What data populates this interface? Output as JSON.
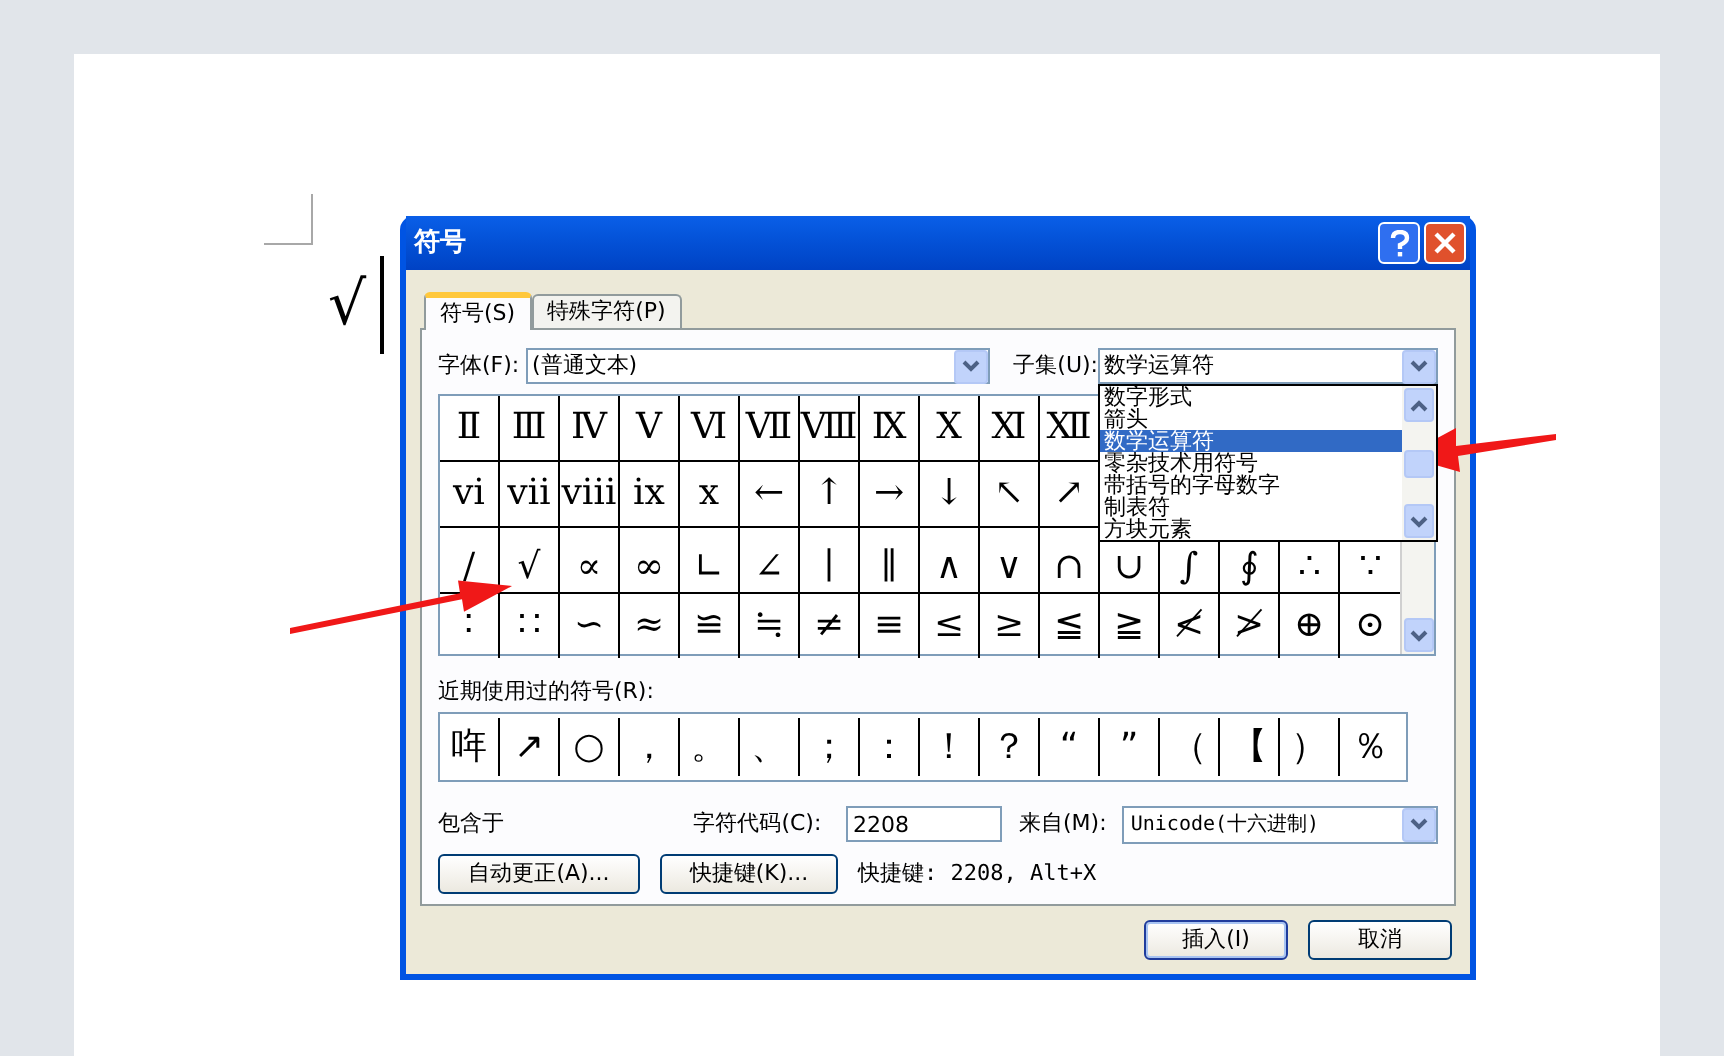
{
  "document": {
    "text": "√"
  },
  "window": {
    "title": "符号"
  },
  "tabs": [
    {
      "label": "符号(S)",
      "selected": true
    },
    {
      "label": "特殊字符(P)",
      "selected": false
    }
  ],
  "font": {
    "label": "字体(F):",
    "value": "(普通文本)"
  },
  "subset": {
    "label": "子集(U):",
    "value": "数学运算符",
    "expanded": true,
    "options": [
      {
        "label": "数字形式",
        "selected": false
      },
      {
        "label": "箭头",
        "selected": false
      },
      {
        "label": "数学运算符",
        "selected": true
      },
      {
        "label": "零杂技术用符号",
        "selected": false
      },
      {
        "label": "带括号的字母数字",
        "selected": false
      },
      {
        "label": "制表符",
        "selected": false
      },
      {
        "label": "方块元素",
        "selected": false
      }
    ]
  },
  "symbols": [
    [
      "Ⅱ",
      "Ⅲ",
      "Ⅳ",
      "Ⅴ",
      "Ⅵ",
      "Ⅶ",
      "Ⅷ",
      "Ⅸ",
      "Ⅹ",
      "Ⅺ",
      "Ⅻ"
    ],
    [
      "ⅵ",
      "ⅶ",
      "ⅷ",
      "ⅸ",
      "ⅹ",
      "←",
      "↑",
      "→",
      "↓",
      "↖",
      "↗"
    ],
    [
      "∕",
      "√",
      "∝",
      "∞",
      "∟",
      "∠",
      "∣",
      "∥",
      "∧",
      "∨",
      "∩",
      "∪",
      "∫",
      "∮",
      "∴",
      "∵"
    ],
    [
      "∶",
      "∷",
      "∽",
      "≈",
      "≌",
      "≒",
      "≠",
      "≡",
      "≤",
      "≥",
      "≦",
      "≧",
      "≮",
      "≯",
      "⊕",
      "⊙"
    ]
  ],
  "recent": {
    "label": "近期使用过的符号(R):",
    "symbols": [
      "哖",
      "↗",
      "○",
      "，",
      "。",
      "、",
      "；",
      "：",
      "！",
      "？",
      "“",
      "”",
      "（",
      "【",
      "）",
      "％"
    ]
  },
  "contained_in": "包含于",
  "char_code": {
    "label": "字符代码(C):",
    "value": "2208"
  },
  "source": {
    "label": "来自(M):",
    "value": "Unicode(十六进制)"
  },
  "option_buttons": [
    {
      "label": "自动更正(A)..."
    },
    {
      "label": "快捷键(K)..."
    }
  ],
  "shortcut": "快捷键: 2208, Alt+X",
  "footer_buttons": [
    {
      "label": "插入(I)",
      "kind": "default"
    },
    {
      "label": "取消",
      "kind": "normal"
    }
  ]
}
